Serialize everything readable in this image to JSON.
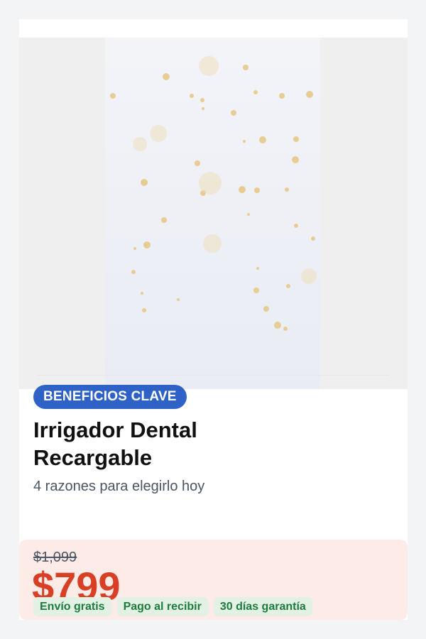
{
  "badge": "BENEFICIOS CLAVE",
  "product": {
    "title": "Irrigador Dental Recargable",
    "subtitle": "4 razones para elegirlo hoy"
  },
  "pricing": {
    "old_price": "$1,099",
    "new_price": "$799"
  },
  "chips": [
    "Envío gratis",
    "Pago al recibir",
    "30 días garantía"
  ],
  "colors": {
    "badge_bg": "#2f62c7",
    "price_accent": "#d93f24",
    "chip_text": "#1f7a3e",
    "price_panel_bg": "#fdebe8"
  }
}
